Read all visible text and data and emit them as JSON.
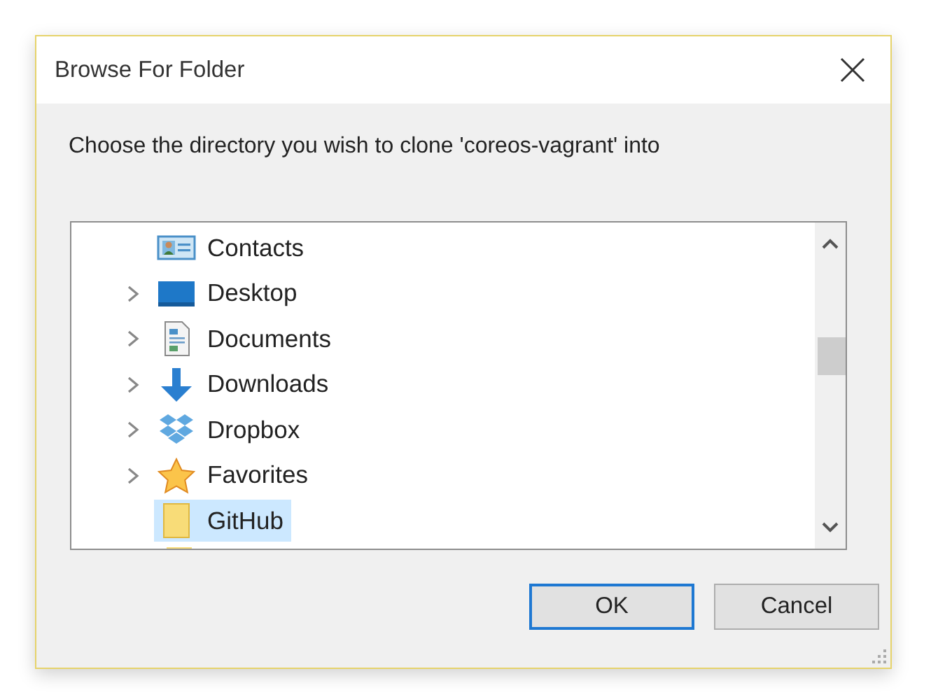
{
  "window": {
    "title": "Browse For Folder"
  },
  "message": "Choose the directory you wish to clone 'coreos-vagrant' into",
  "tree": {
    "items": [
      {
        "label": "Contacts",
        "kind": "contacts",
        "expandable": false,
        "selected": false
      },
      {
        "label": "Desktop",
        "kind": "desktop",
        "expandable": true,
        "selected": false
      },
      {
        "label": "Documents",
        "kind": "documents",
        "expandable": true,
        "selected": false
      },
      {
        "label": "Downloads",
        "kind": "downloads",
        "expandable": true,
        "selected": false
      },
      {
        "label": "Dropbox",
        "kind": "dropbox",
        "expandable": true,
        "selected": false
      },
      {
        "label": "Favorites",
        "kind": "favorites",
        "expandable": true,
        "selected": false
      },
      {
        "label": "GitHub",
        "kind": "folder",
        "expandable": false,
        "selected": true
      }
    ]
  },
  "buttons": [
    {
      "label": "OK",
      "default": true
    },
    {
      "label": "Cancel",
      "default": false
    }
  ]
}
